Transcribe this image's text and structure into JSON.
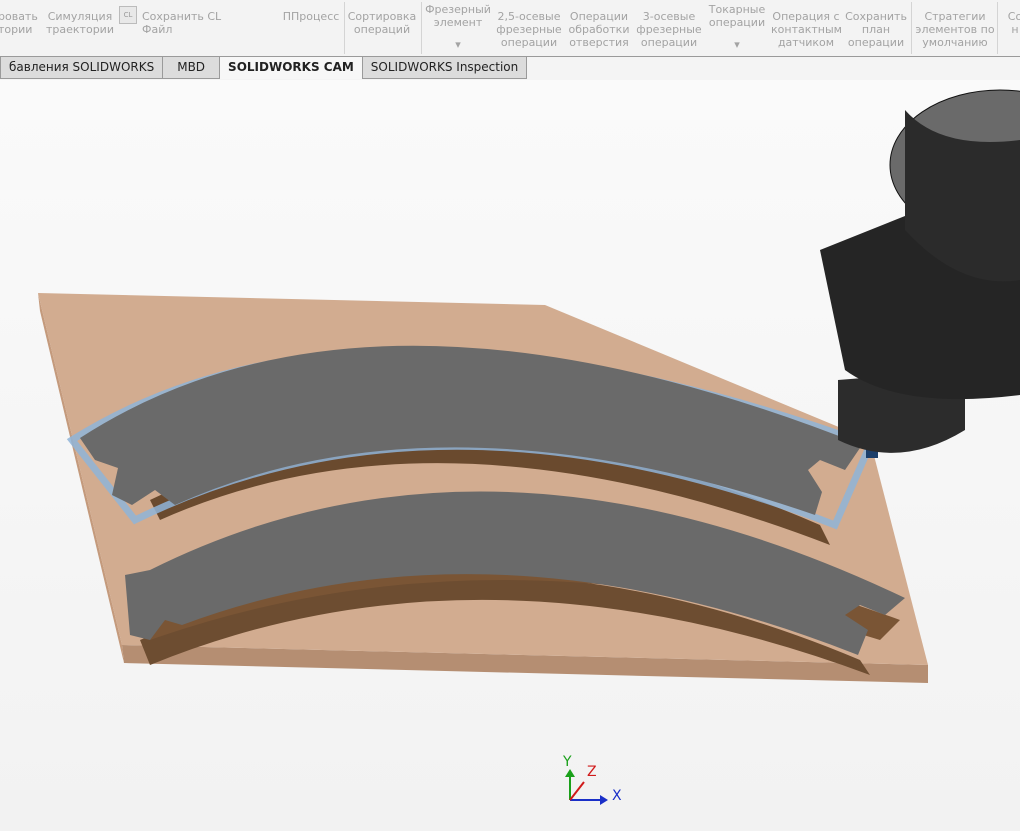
{
  "ribbon": {
    "buttons": [
      {
        "label": "ровать\nтории"
      },
      {
        "label": "Симуляция\nтраектории"
      },
      {
        "label": "Сохранить CL Файл",
        "icon": "cl-file-icon"
      },
      {
        "label": "ППроцесс"
      },
      {
        "label": "Сортировка\nопераций"
      },
      {
        "label": "Фрезерный\nэлемент"
      },
      {
        "label": "2,5-осевые\nфрезерные\nоперации"
      },
      {
        "label": "Операции\nобработки\nотверстия"
      },
      {
        "label": "3-осевые\nфрезерные\nоперации"
      },
      {
        "label": "Токарные\nоперации"
      },
      {
        "label": "Операция с\nконтактным\nдатчиком"
      },
      {
        "label": "Сохранить\nплан\nоперации"
      },
      {
        "label": "Стратегии\nэлементов по\nумолчанию"
      },
      {
        "label": "Со\nн"
      }
    ],
    "cl_icon_text": "CL"
  },
  "tabs": [
    {
      "label": "бавления SOLIDWORKS"
    },
    {
      "label": "MBD"
    },
    {
      "label": "SOLIDWORKS CAM",
      "active": true
    },
    {
      "label": "SOLIDWORKS Inspection"
    }
  ],
  "triad": {
    "x": "X",
    "y": "Y",
    "z": "Z",
    "colors": {
      "x": "#1a2fc8",
      "y": "#1aa01a",
      "z": "#d01a1a"
    }
  },
  "colors": {
    "stock": "#d4a27e",
    "part": "#6b6b6b",
    "toolpath": "#8fb4d8",
    "tool": "#2a2a2a"
  }
}
